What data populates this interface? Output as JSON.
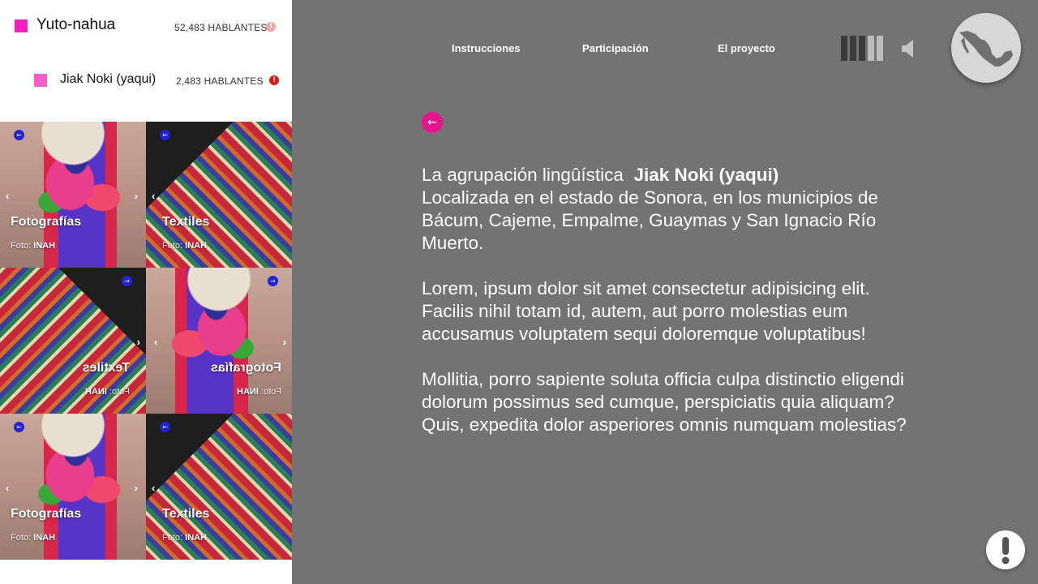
{
  "family": {
    "name": "Yuto-nahua",
    "speakers": "52,483 HABLANTES",
    "color": "#f21fb8",
    "alert_icon": "alert-circle-icon",
    "alert_color": "#f0a9a9"
  },
  "group": {
    "name": "Jiak Noki (yaqui)",
    "speakers": "2,483 HABLANTES",
    "color": "#f35cc9",
    "alert_icon": "alert-circle-icon",
    "alert_color": "#e01616"
  },
  "gallery": {
    "tiles": [
      {
        "title": "Fotografías",
        "credit_prefix": "Foto:",
        "credit_source": "INAH",
        "kind": "photo"
      },
      {
        "title": "Textiles",
        "credit_prefix": "Foto:",
        "credit_source": "INAH",
        "kind": "textile"
      },
      {
        "title": "Textiles",
        "credit_prefix": "Foto:",
        "credit_source": "INAH",
        "kind": "textile"
      },
      {
        "title": "Fotografías",
        "credit_prefix": "Foto:",
        "credit_source": "INAH",
        "kind": "photo"
      },
      {
        "title": "Fotografías",
        "credit_prefix": "Foto:",
        "credit_source": "INAH",
        "kind": "photo"
      },
      {
        "title": "Textiles",
        "credit_prefix": "Foto:",
        "credit_source": "INAH",
        "kind": "textile"
      }
    ]
  },
  "nav": {
    "instructions": "Instrucciones",
    "participation": "Participación",
    "project": "El proyecto"
  },
  "volume": {
    "level": 0.4,
    "icon": "speaker-icon"
  },
  "map_button": {
    "icon": "mexico-map-icon"
  },
  "back_button": {
    "icon": "arrow-left-icon"
  },
  "content": {
    "intro_lead": "La agrupación lingûística",
    "intro_group": "Jiak Noki (yaqui)",
    "location": "Localizada en el estado de Sonora, en los municipios de Bácum, Cajeme, Empalme, Guaymas y San Ignacio Río Muerto.",
    "paragraph2": "Lorem, ipsum dolor sit amet consectetur adipisicing elit. Facilis nihil totam id, autem, aut porro molestias eum accusamus voluptatem sequi doloremque voluptatibus!",
    "paragraph3": "Mollitia, porro sapiente soluta officia culpa distinctio eligendi dolorum possimus sed cumque, perspiciatis quia aliquam? Quis, expedita dolor asperiores omnis numquam molestias?"
  },
  "help_button": {
    "icon": "exclamation-icon"
  }
}
